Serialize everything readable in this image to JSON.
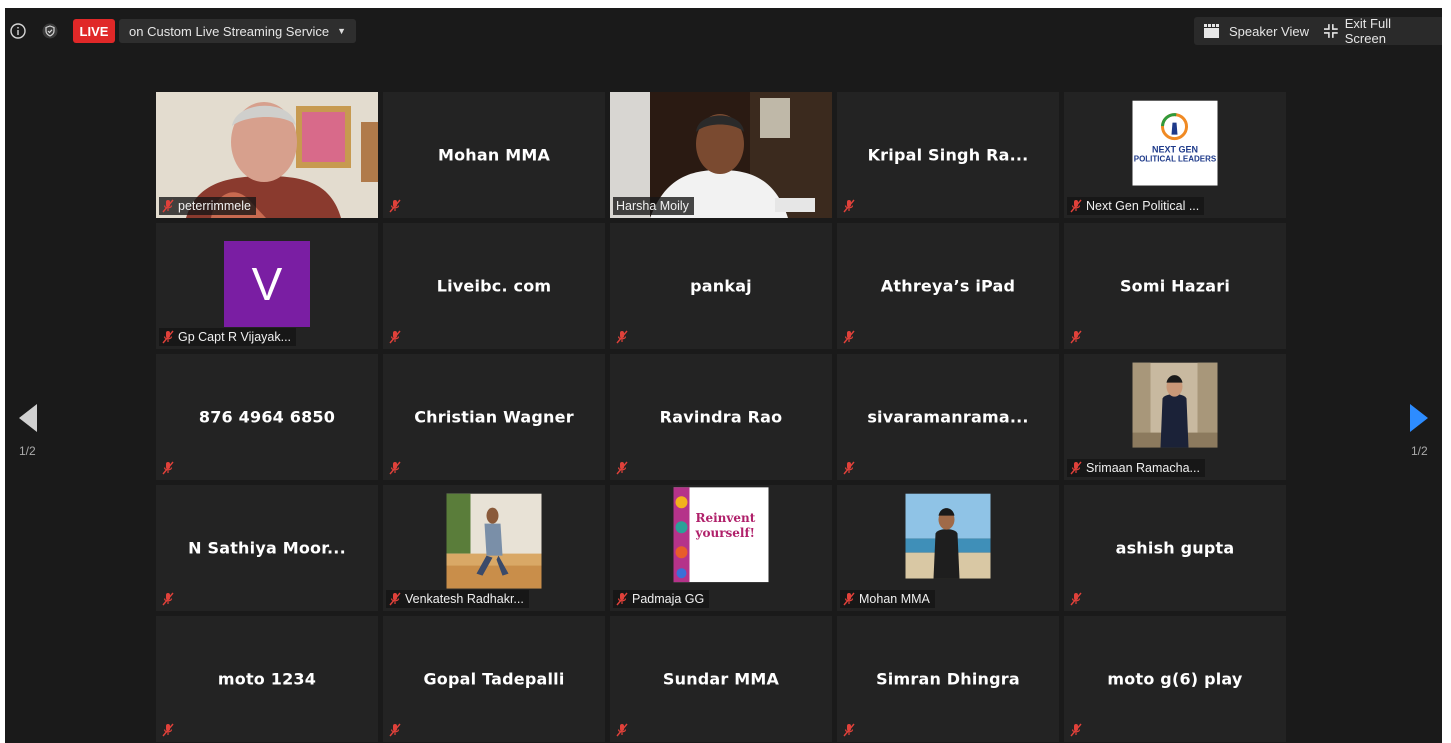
{
  "topbar": {
    "info_icon": "info-icon",
    "shield_icon": "shield-icon",
    "live_label": "LIVE",
    "stream_label": "on Custom Live Streaming Service",
    "speaker_view_label": "Speaker View",
    "exit_fullscreen_label": "Exit Full Screen"
  },
  "pager": {
    "left_page": "1/2",
    "right_page": "1/2"
  },
  "colors": {
    "active_border": "#c6e37a",
    "live_red": "#e02828",
    "next_arrow": "#2d8cff",
    "muted_mic": "#e0413a"
  },
  "tiles": [
    {
      "kind": "video-peter",
      "name": "",
      "label": "peterrimmele"
    },
    {
      "kind": "name",
      "name": "Mohan MMA",
      "label": ""
    },
    {
      "kind": "video-harsha",
      "name": "",
      "label": "Harsha Moily",
      "active": true
    },
    {
      "kind": "name",
      "name": "Kripal Singh Ra...",
      "label": ""
    },
    {
      "kind": "logo-nextgen",
      "name": "",
      "label": "Next Gen Political ...",
      "logo_text": [
        "NEXT GEN",
        "POLITICAL LEADERS"
      ]
    },
    {
      "kind": "letter",
      "name": "",
      "letter": "V",
      "label": "Gp Capt R Vijayak..."
    },
    {
      "kind": "name",
      "name": "Liveibc. com",
      "label": ""
    },
    {
      "kind": "name",
      "name": "pankaj",
      "label": ""
    },
    {
      "kind": "name",
      "name": "Athreya’s iPad",
      "label": ""
    },
    {
      "kind": "name",
      "name": "Somi Hazari",
      "label": ""
    },
    {
      "kind": "name",
      "name": "876 4964 6850",
      "label": ""
    },
    {
      "kind": "name",
      "name": "Christian Wagner",
      "label": ""
    },
    {
      "kind": "name",
      "name": "Ravindra Rao",
      "label": ""
    },
    {
      "kind": "name",
      "name": "sivaramanrama...",
      "label": ""
    },
    {
      "kind": "photo-suit",
      "name": "",
      "label": "Srimaan Ramacha..."
    },
    {
      "kind": "name",
      "name": "N Sathiya Moor...",
      "label": ""
    },
    {
      "kind": "photo-venkatesh",
      "name": "",
      "label": "Venkatesh Radhakr..."
    },
    {
      "kind": "photo-reinvent",
      "name": "",
      "label": "Padmaja GG",
      "photo_text": [
        "Reinvent",
        "yourself!"
      ]
    },
    {
      "kind": "photo-beach",
      "name": "",
      "label": "Mohan MMA"
    },
    {
      "kind": "name",
      "name": "ashish gupta",
      "label": ""
    },
    {
      "kind": "name",
      "name": "moto 1234",
      "label": ""
    },
    {
      "kind": "name",
      "name": "Gopal Tadepalli",
      "label": ""
    },
    {
      "kind": "name",
      "name": "Sundar MMA",
      "label": ""
    },
    {
      "kind": "name",
      "name": "Simran Dhingra",
      "label": ""
    },
    {
      "kind": "name",
      "name": "moto g(6) play",
      "label": ""
    }
  ]
}
